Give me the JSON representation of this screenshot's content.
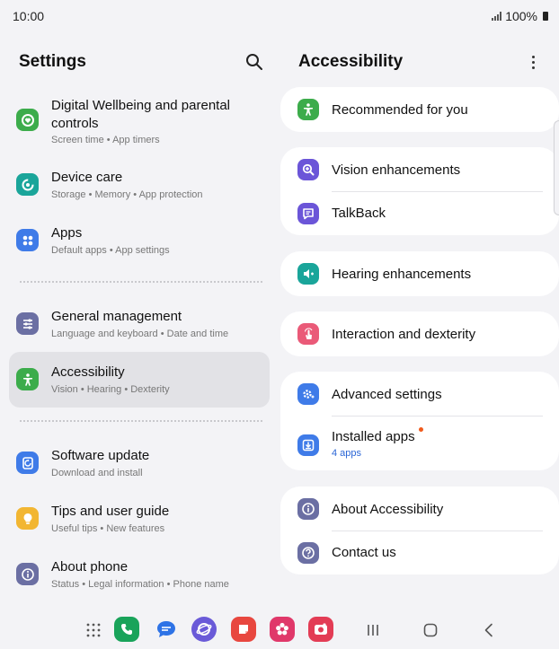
{
  "status": {
    "time": "10:00",
    "battery": "100%"
  },
  "left": {
    "title": "Settings",
    "items": [
      {
        "title": "Digital Wellbeing and parental controls",
        "subtitle": [
          "Screen time",
          "App timers"
        ],
        "color": "#3cac4b",
        "icon": "wellbeing-icon"
      },
      {
        "title": "Device care",
        "subtitle": [
          "Storage",
          "Memory",
          "App protection"
        ],
        "color": "#1aa59a",
        "icon": "device-care-icon"
      },
      {
        "title": "Apps",
        "subtitle": [
          "Default apps",
          "App settings"
        ],
        "color": "#3f7be8",
        "icon": "apps-icon"
      },
      {
        "title": "General management",
        "subtitle": [
          "Language and keyboard",
          "Date and time"
        ],
        "color": "#6b6fa3",
        "icon": "general-management-icon"
      },
      {
        "title": "Accessibility",
        "subtitle": [
          "Vision",
          "Hearing",
          "Dexterity"
        ],
        "color": "#3cac4b",
        "icon": "accessibility-icon"
      },
      {
        "title": "Software update",
        "subtitle": [
          "Download and install"
        ],
        "color": "#3f7be8",
        "icon": "software-update-icon"
      },
      {
        "title": "Tips and user guide",
        "subtitle": [
          "Useful tips",
          "New features"
        ],
        "color": "#f2b632",
        "icon": "tips-icon"
      },
      {
        "title": "About phone",
        "subtitle": [
          "Status",
          "Legal information",
          "Phone name"
        ],
        "color": "#6b6fa3",
        "icon": "info-icon"
      }
    ]
  },
  "right": {
    "title": "Accessibility",
    "rows": [
      {
        "label": "Recommended for you",
        "color": "#3cac4b",
        "icon": "accessibility-icon"
      },
      {
        "label": "Vision enhancements",
        "color": "#6b55d8",
        "icon": "magnifier-icon"
      },
      {
        "label": "TalkBack",
        "color": "#6b55d8",
        "icon": "talkback-icon"
      },
      {
        "label": "Hearing enhancements",
        "color": "#1aa59a",
        "icon": "hearing-icon"
      },
      {
        "label": "Interaction and dexterity",
        "color": "#ea5a78",
        "icon": "touch-icon"
      },
      {
        "label": "Advanced settings",
        "color": "#3f7be8",
        "icon": "advanced-settings-icon"
      },
      {
        "label": "Installed apps",
        "sub": "4 apps",
        "color": "#3f7be8",
        "icon": "download-icon"
      },
      {
        "label": "About Accessibility",
        "color": "#6b6fa3",
        "icon": "info-icon"
      },
      {
        "label": "Contact us",
        "color": "#6b6fa3",
        "icon": "question-icon"
      }
    ]
  },
  "dock": {
    "apps": [
      {
        "name": "phone",
        "color": "#19a35a"
      },
      {
        "name": "messages",
        "color": "#2e73e6"
      },
      {
        "name": "internet",
        "color": "#6a5ad8"
      },
      {
        "name": "notes",
        "color": "#e8473f"
      },
      {
        "name": "gallery",
        "color": "#e0386a"
      },
      {
        "name": "camera",
        "color": "#e33c55"
      }
    ]
  }
}
